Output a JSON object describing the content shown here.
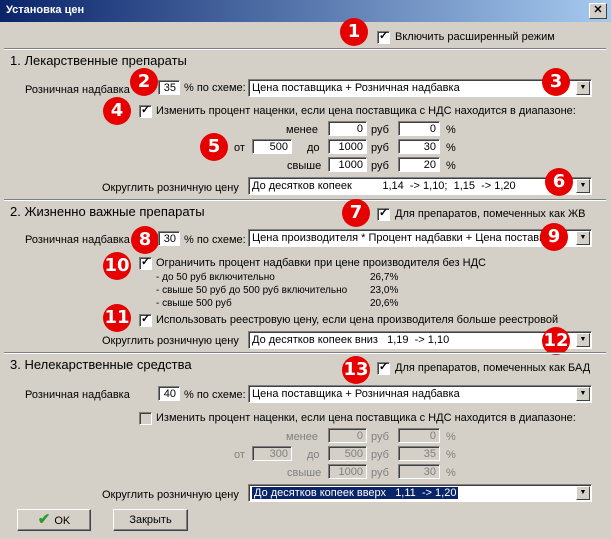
{
  "window": {
    "title": "Установка цен",
    "close": "✕"
  },
  "badges": [
    "1",
    "2",
    "3",
    "4",
    "5",
    "6",
    "7",
    "8",
    "9",
    "10",
    "11",
    "12",
    "13"
  ],
  "top": {
    "extended_mode": "Включить расширенный режим"
  },
  "s1": {
    "title": "1. Лекарственные препараты",
    "markup_label": "Розничная надбавка",
    "markup_value": "35",
    "scheme_label": "% по схеме:",
    "scheme_value": "Цена поставщика + Розничная надбавка",
    "change_label": "Изменить процент наценки, если цена поставщика с НДС находится в диапазоне:",
    "less": "менее",
    "less_val": "0",
    "rub": "руб",
    "less_pct": "0",
    "pct": "%",
    "from": "от",
    "from_val": "500",
    "to": "до",
    "to_val": "1000",
    "to_pct": "30",
    "above": "свыше",
    "above_val": "1000",
    "above_pct": "20",
    "round_label": "Округлить розничную цену",
    "round_value": "До десятков копеек          1,14  -> 1,10;  1,15  -> 1,20"
  },
  "s2": {
    "title": "2. Жизненно важные препараты",
    "zhv_label": "Для препаратов, помеченных как ЖВ",
    "markup_label": "Розничная надбавка",
    "markup_value": "30",
    "scheme_label": "% по схеме:",
    "scheme_value": "Цена производителя * Процент надбавки + Цена поставщика",
    "limit_label": "Ограничить процент надбавки при цене производителя без НДС",
    "limits": [
      {
        "label": "- до 50 руб  включительно",
        "value": "26,7%"
      },
      {
        "label": "- свыше 50 руб до 500 руб включительно",
        "value": "23,0%"
      },
      {
        "label": "- свыше 500 руб",
        "value": "20,6%"
      }
    ],
    "registry_label": "Использовать реестровую цену, если цена производителя больше реестровой",
    "round_label": "Округлить розничную цену",
    "round_value": "До десятков копеек вниз   1,19  -> 1,10"
  },
  "s3": {
    "title": "3. Нелекарственные средства",
    "bad_label": "Для препаратов, помеченных как БАД",
    "markup_label": "Розничная надбавка",
    "markup_value": "40",
    "scheme_label": "% по схеме:",
    "scheme_value": "Цена поставщика + Розничная надбавка",
    "change_label": "Изменить процент наценки, если цена поставщика с НДС находится в диапазоне:",
    "less": "менее",
    "less_val": "0",
    "rub": "руб",
    "less_pct": "0",
    "pct": "%",
    "from": "от",
    "from_val": "300",
    "to": "до",
    "to_val": "500",
    "to_pct": "35",
    "above": "свыше",
    "above_val": "1000",
    "above_pct": "30",
    "round_label": "Округлить розничную цену",
    "round_value": "До десятков копеек вверх   1,11  -> 1,20"
  },
  "buttons": {
    "ok": "OK",
    "close": "Закрыть"
  }
}
